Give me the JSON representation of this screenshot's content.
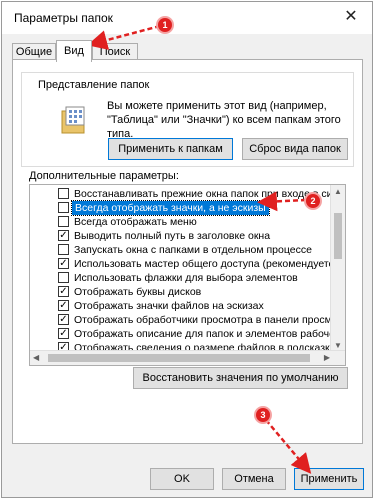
{
  "window": {
    "title": "Параметры папок"
  },
  "tabs": [
    {
      "label": "Общие"
    },
    {
      "label": "Вид"
    },
    {
      "label": "Поиск"
    }
  ],
  "folder_view": {
    "group_label": "Представление папок",
    "description": "Вы можете применить этот вид (например, \"Таблица\" или \"Значки\") ко всем папкам этого типа.",
    "apply_button": "Применить к папкам",
    "reset_button": "Сброс вида папок"
  },
  "advanced": {
    "label": "Дополнительные параметры:",
    "items": [
      {
        "label": "Восстанавливать прежние окна папок при входе в систе",
        "checked": ""
      },
      {
        "label": "Всегда отображать значки, а не эскизы",
        "checked": ""
      },
      {
        "label": "Всегда отображать меню",
        "checked": ""
      },
      {
        "label": "Выводить полный путь в заголовке окна",
        "checked": "✓"
      },
      {
        "label": "Запускать окна с папками в отдельном процессе",
        "checked": ""
      },
      {
        "label": "Использовать мастер общего доступа (рекомендуется)",
        "checked": "✓"
      },
      {
        "label": "Использовать флажки для выбора элементов",
        "checked": ""
      },
      {
        "label": "Отображать буквы дисков",
        "checked": "✓"
      },
      {
        "label": "Отображать значки файлов на эскизах",
        "checked": "✓"
      },
      {
        "label": "Отображать обработчики просмотра в панели просмотр",
        "checked": "✓"
      },
      {
        "label": "Отображать описание для папок и элементов рабочего с",
        "checked": "✓"
      },
      {
        "label": "Отображать сведения о размере файлов в подсказках па",
        "checked": "✓"
      }
    ]
  },
  "restore_button": "Восстановить значения по умолчанию",
  "footer": {
    "ok": "OK",
    "cancel": "Отмена",
    "apply": "Применить"
  },
  "annotations": {
    "b1": "1",
    "b2": "2",
    "b3": "3"
  },
  "colors": {
    "accent": "#0078d7",
    "annotation": "#e02020"
  }
}
